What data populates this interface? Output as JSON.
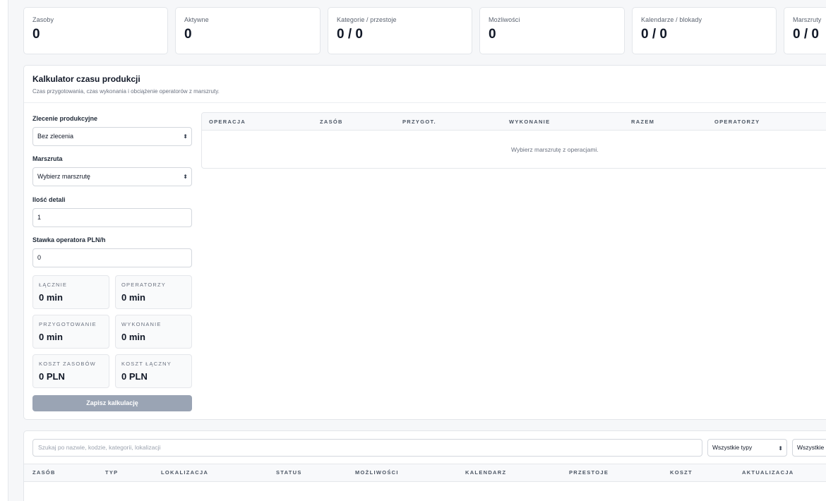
{
  "stats": [
    {
      "label": "Zasoby",
      "value": "0"
    },
    {
      "label": "Aktywne",
      "value": "0"
    },
    {
      "label": "Kategorie / przestoje",
      "value": "0 / 0"
    },
    {
      "label": "Możliwości",
      "value": "0"
    },
    {
      "label": "Kalendarze / blokady",
      "value": "0 / 0"
    },
    {
      "label": "Marszruty",
      "value": "0 / 0"
    }
  ],
  "calculator": {
    "title": "Kalkulator czasu produkcji",
    "subtitle": "Czas przygotowania, czas wykonania i obciążenie operatorów z marszruty.",
    "order_label": "Zlecenie produkcyjne",
    "order_value": "Bez zlecenia",
    "route_label": "Marszruta",
    "route_value": "Wybierz marszrutę",
    "qty_label": "Ilość detali",
    "qty_value": "1",
    "rate_label": "Stawka operatora PLN/h",
    "rate_value": "0",
    "metrics": [
      {
        "label": "ŁĄCZNIE",
        "value": "0 min"
      },
      {
        "label": "OPERATORZY",
        "value": "0 min"
      },
      {
        "label": "PRZYGOTOWANIE",
        "value": "0 min"
      },
      {
        "label": "WYKONANIE",
        "value": "0 min"
      },
      {
        "label": "KOSZT ZASOBÓW",
        "value": "0 PLN"
      },
      {
        "label": "KOSZT ŁĄCZNY",
        "value": "0 PLN"
      }
    ],
    "save_label": "Zapisz kalkulację",
    "table_headers": [
      "OPERACJA",
      "ZASÓB",
      "PRZYGOT.",
      "WYKONANIE",
      "RAZEM",
      "OPERATORZY"
    ],
    "empty_text": "Wybierz marszrutę z operacjami."
  },
  "resources": {
    "search_placeholder": "Szukaj po nazwie, kodzie, kategorii, lokalizacji",
    "type_filter": "Wszystkie typy",
    "second_filter": "Wszystkie",
    "headers": [
      "ZASÓB",
      "TYP",
      "LOKALIZACJA",
      "STATUS",
      "MOŻLIWOŚCI",
      "KALENDARZ",
      "PRZESTOJE",
      "KOSZT",
      "AKTUALIZACJA"
    ]
  }
}
